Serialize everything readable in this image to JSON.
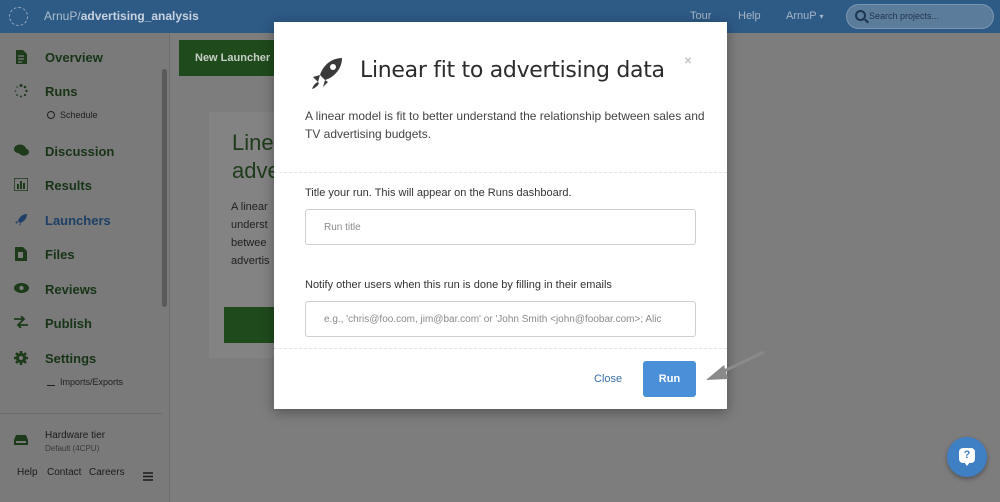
{
  "header": {
    "owner": "ArnuP/",
    "project": "advertising_analysis",
    "links": [
      "Tour",
      "Help",
      "ArnuP"
    ],
    "user_caret": "▾",
    "search_placeholder": "Search projects..."
  },
  "sidebar": {
    "items": [
      {
        "label": "Overview",
        "icon": "document-icon"
      },
      {
        "label": "Runs",
        "icon": "spinner-icon"
      },
      {
        "label": "Discussion",
        "icon": "chat-icon"
      },
      {
        "label": "Results",
        "icon": "bar-chart-icon"
      },
      {
        "label": "Launchers",
        "icon": "rocket-icon"
      },
      {
        "label": "Files",
        "icon": "files-icon"
      },
      {
        "label": "Reviews",
        "icon": "eye-icon"
      },
      {
        "label": "Publish",
        "icon": "arrows-icon"
      },
      {
        "label": "Settings",
        "icon": "gear-icon"
      }
    ],
    "schedule_label": "Schedule",
    "imports_label": "Imports/Exports",
    "hardware_label": "Hardware tier",
    "hardware_sub": "Default (4CPU)",
    "footer_links": [
      "Help",
      "Contact",
      "Careers"
    ]
  },
  "background": {
    "new_launcher_label": "New Launcher",
    "card_title_lines": [
      "Linear",
      "adver"
    ],
    "card_text_lines": [
      "A linear",
      "underst",
      "betwee",
      "advertis"
    ]
  },
  "modal": {
    "title": "Linear fit to advertising data",
    "close_glyph": "×",
    "description": "A linear model is fit to better understand the relationship between sales and TV advertising budgets.",
    "title_field_label": "Title your run. This will appear on the Runs dashboard.",
    "title_field_placeholder": "Run title",
    "notify_field_label": "Notify other users when this run is done by filling in their emails",
    "notify_field_placeholder": "e.g., 'chris@foo.com, jim@bar.com' or 'John Smith <john@foobar.com>; Alic",
    "close_button": "Close",
    "run_button": "Run"
  },
  "help_widget": {
    "glyph": "?"
  },
  "colors": {
    "header_bg": "#2e5a86",
    "launcher_green": "#1f4a1c",
    "run_button": "#4a90d9",
    "link_blue": "#3a6fa8"
  }
}
